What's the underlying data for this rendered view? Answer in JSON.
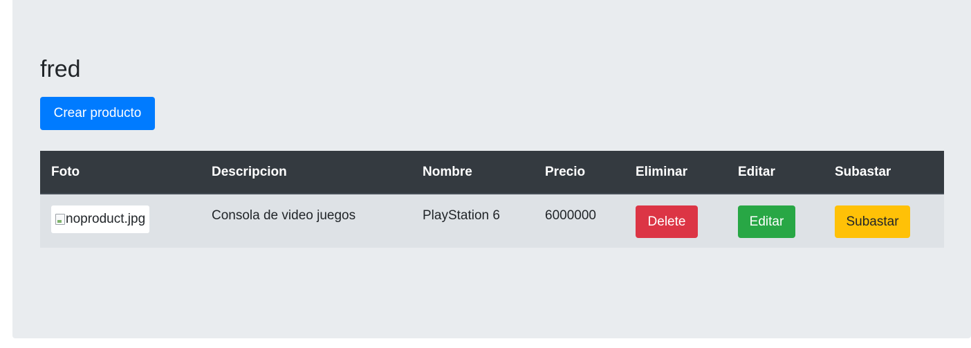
{
  "page": {
    "title": "fred",
    "create_button": "Crear producto"
  },
  "table": {
    "headers": [
      "Foto",
      "Descripcion",
      "Nombre",
      "Precio",
      "Eliminar",
      "Editar",
      "Subastar"
    ],
    "rows": [
      {
        "foto_alt": "noproduct.jpg",
        "descripcion": "Consola de video juegos",
        "nombre": "PlayStation 6",
        "precio": "6000000",
        "delete_label": "Delete",
        "edit_label": "Editar",
        "auction_label": "Subastar"
      }
    ]
  },
  "colors": {
    "background": "#e9ecef",
    "primary": "#007bff",
    "danger": "#dc3545",
    "success": "#28a745",
    "warning": "#ffc107",
    "table_header": "#343a40",
    "table_row": "#dee2e6"
  }
}
